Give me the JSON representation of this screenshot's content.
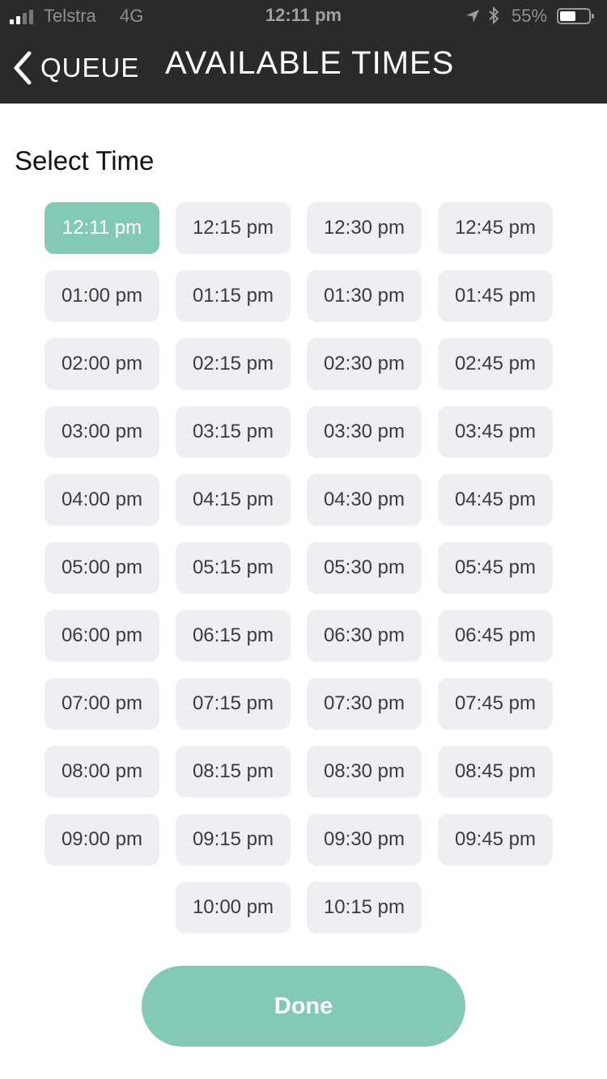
{
  "status_bar": {
    "carrier": "Telstra",
    "network": "4G",
    "time": "12:11 pm",
    "battery_percent": "55%",
    "battery_level": 0.55
  },
  "nav": {
    "back_label": "QUEUE",
    "title": "AVAILABLE TIMES"
  },
  "section_label": "Select Time",
  "selected_slot": "12:11 pm",
  "slots": [
    "12:11 pm",
    "12:15 pm",
    "12:30 pm",
    "12:45 pm",
    "01:00 pm",
    "01:15 pm",
    "01:30 pm",
    "01:45 pm",
    "02:00 pm",
    "02:15 pm",
    "02:30 pm",
    "02:45 pm",
    "03:00 pm",
    "03:15 pm",
    "03:30 pm",
    "03:45 pm",
    "04:00 pm",
    "04:15 pm",
    "04:30 pm",
    "04:45 pm",
    "05:00 pm",
    "05:15 pm",
    "05:30 pm",
    "05:45 pm",
    "06:00 pm",
    "06:15 pm",
    "06:30 pm",
    "06:45 pm",
    "07:00 pm",
    "07:15 pm",
    "07:30 pm",
    "07:45 pm",
    "08:00 pm",
    "08:15 pm",
    "08:30 pm",
    "08:45 pm",
    "09:00 pm",
    "09:15 pm",
    "09:30 pm",
    "09:45 pm",
    "10:00 pm",
    "10:15 pm"
  ],
  "done_label": "Done",
  "colors": {
    "accent": "#84c9b5",
    "header_bg": "#2a2a2a",
    "slot_bg": "#efeff3"
  }
}
